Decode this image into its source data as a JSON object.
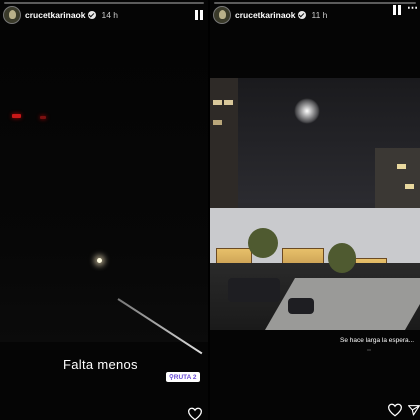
{
  "left_story": {
    "username": "crucetkarinaok",
    "time": "14 h",
    "caption": "Falta menos",
    "sticker": "RUTA 2",
    "progress": 0.0
  },
  "right_story": {
    "username": "crucetkarinaok",
    "time": "11 h",
    "caption": "Se hace larga la espera...",
    "tag": "",
    "progress": 0.0
  },
  "icons": [
    "verified-icon",
    "pause-icon",
    "more-icon",
    "heart-icon",
    "send-icon",
    "location-pin-icon"
  ],
  "colors": {
    "sticker_text": "#6a4bd6",
    "background": "#000000"
  }
}
